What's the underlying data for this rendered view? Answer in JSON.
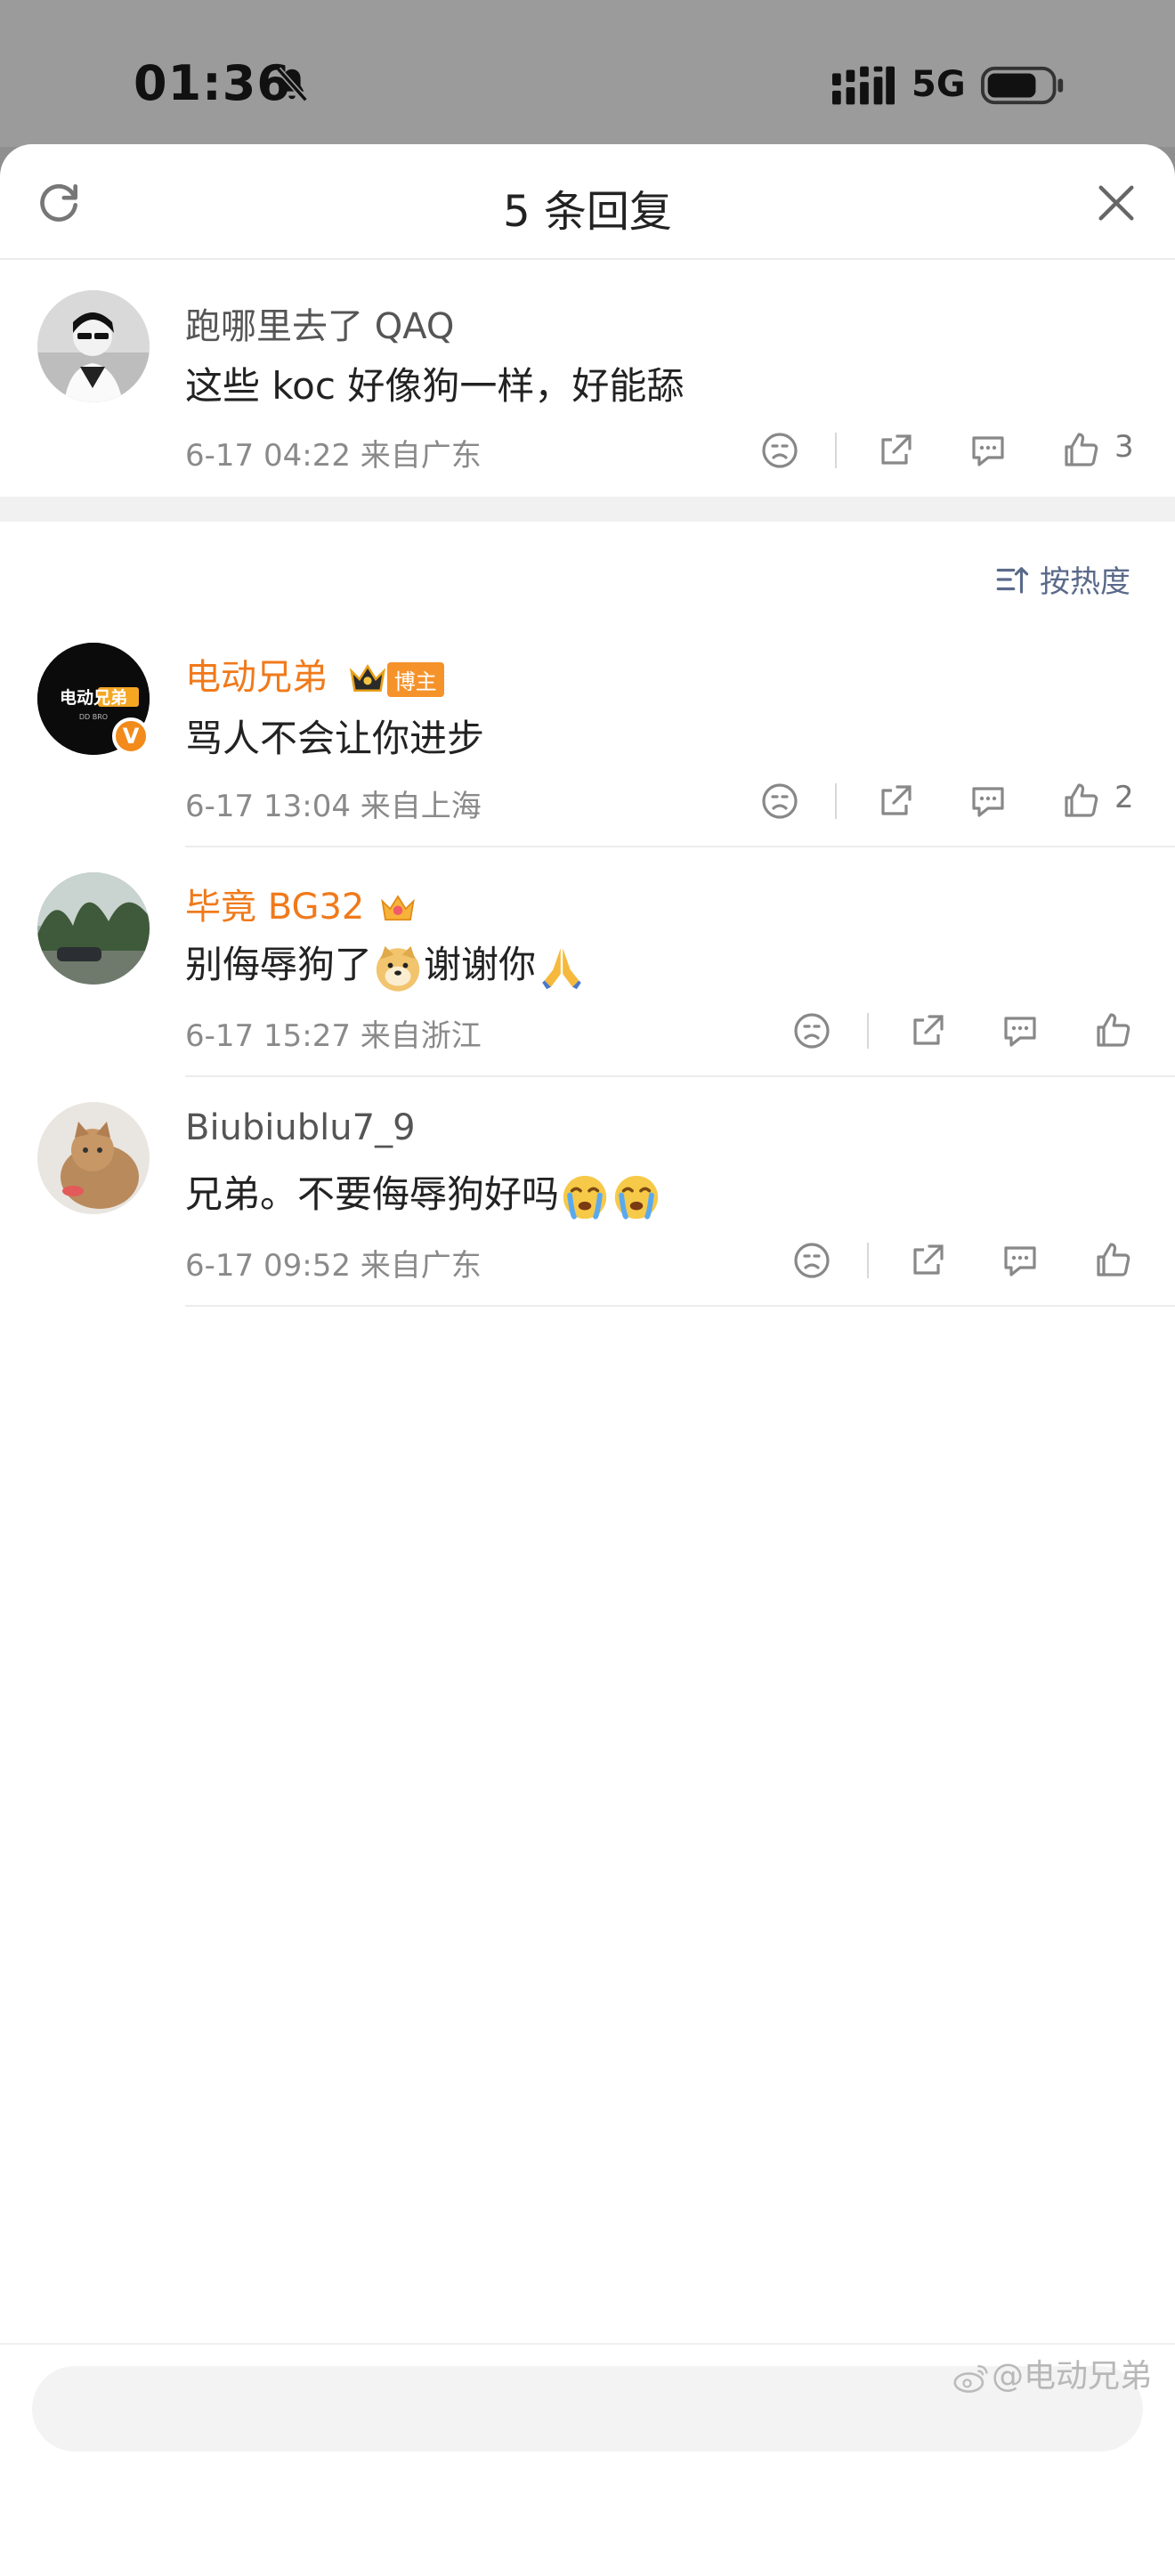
{
  "status_bar": {
    "time": "01:36",
    "network": "5G"
  },
  "sheet": {
    "title": "5 条回复"
  },
  "root_comment": {
    "username": "跑哪里去了 QAQ",
    "content": "这些 koc 好像狗一样，好能舔",
    "meta": "6-17 04:22  来自广东",
    "likes": "3"
  },
  "sort": {
    "label": "按热度"
  },
  "replies": [
    {
      "username": "电动兄弟",
      "badge": "博主",
      "avatar_text": "电动兄弟",
      "avatar_sub": "DD BRO",
      "verified": "V",
      "content": "骂人不会让你进步",
      "meta": "6-17 13:04  来自上海",
      "likes": "2"
    },
    {
      "username": "毕竟 BG32",
      "content_a": "别侮辱狗了",
      "content_b": "谢谢你",
      "meta": "6-17 15:27  来自浙江"
    },
    {
      "username": "Biubiublu7_9",
      "content": "兄弟。不要侮辱狗好吗",
      "meta": "6-17 09:52  来自广东"
    }
  ],
  "watermark": "@电动兄弟",
  "icons": [
    "bell-mute-icon",
    "signal-icon",
    "battery-icon",
    "refresh-icon",
    "close-icon",
    "dislike-icon",
    "share-icon",
    "comment-icon",
    "like-icon",
    "sort-icon"
  ]
}
